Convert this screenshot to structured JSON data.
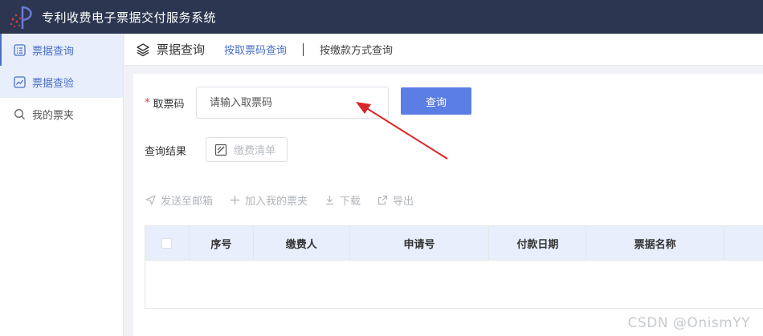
{
  "header": {
    "title": "专利收费电子票据交付服务系统"
  },
  "sidebar": {
    "items": [
      {
        "label": "票据查询",
        "icon": "list-icon"
      },
      {
        "label": "票据查验",
        "icon": "chart-icon"
      },
      {
        "label": "我的票夹",
        "icon": "search-icon"
      }
    ]
  },
  "tabbar": {
    "title": "票据查询",
    "tab_by_code": "按取票码查询",
    "tab_by_method": "按缴款方式查询"
  },
  "form": {
    "required_mark": "*",
    "code_label": "取票码",
    "code_placeholder": "请输入取票码",
    "query_button": "查询"
  },
  "result": {
    "label": "查询结果",
    "fee_list_button": "缴费清单"
  },
  "actions": {
    "send_email": "发送至邮箱",
    "add_folder": "加入我的票夹",
    "download": "下载",
    "export": "导出"
  },
  "table": {
    "columns": [
      "序号",
      "缴费人",
      "申请号",
      "付款日期",
      "票据名称"
    ]
  },
  "watermark": "CSDN @OnismYY",
  "colors": {
    "header_bg": "#2c3650",
    "accent": "#5b7ee5",
    "annotation_arrow": "#d9262b"
  }
}
